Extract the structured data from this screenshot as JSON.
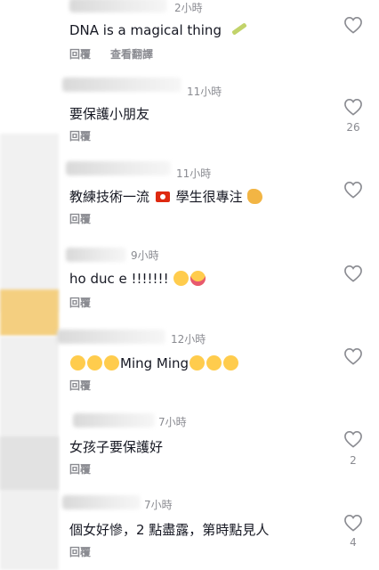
{
  "comments": [
    {
      "time": "2小時",
      "text": "DNA is a magical thing",
      "reply": "回覆",
      "translate": "查看翻譯",
      "likes": ""
    },
    {
      "time": "11小時",
      "text": "要保護小朋友",
      "reply": "回覆",
      "likes": "26"
    },
    {
      "time": "11小時",
      "text": "教練技術一流",
      "text2": "學生很專注",
      "reply": "回覆",
      "likes": ""
    },
    {
      "time": "9小時",
      "text": "ho duc e !!!!!!!",
      "reply": "回覆",
      "likes": ""
    },
    {
      "time": "12小時",
      "text": "Ming Ming",
      "reply": "回覆",
      "likes": ""
    },
    {
      "time": "7小時",
      "text": "女孩子要保護好",
      "reply": "回覆",
      "likes": "2"
    },
    {
      "time": "7小時",
      "text": "個女好慘，2 點盡露，第時點見人",
      "reply": "回覆",
      "likes": "4"
    }
  ],
  "icons": {
    "like": "heart-outline-icon",
    "syringe": "syringe-emoji",
    "flag": "hong-kong-flag-emoji",
    "muscle": "flexed-biceps-emoji",
    "laugh": "grinning-squinting-face-emoji",
    "wink": "winking-tongue-face-emoji",
    "smile": "smiling-face-emoji"
  },
  "colors": {
    "text": "#161823",
    "secondary": "#8a8b91",
    "heart": "#8a8b91"
  }
}
